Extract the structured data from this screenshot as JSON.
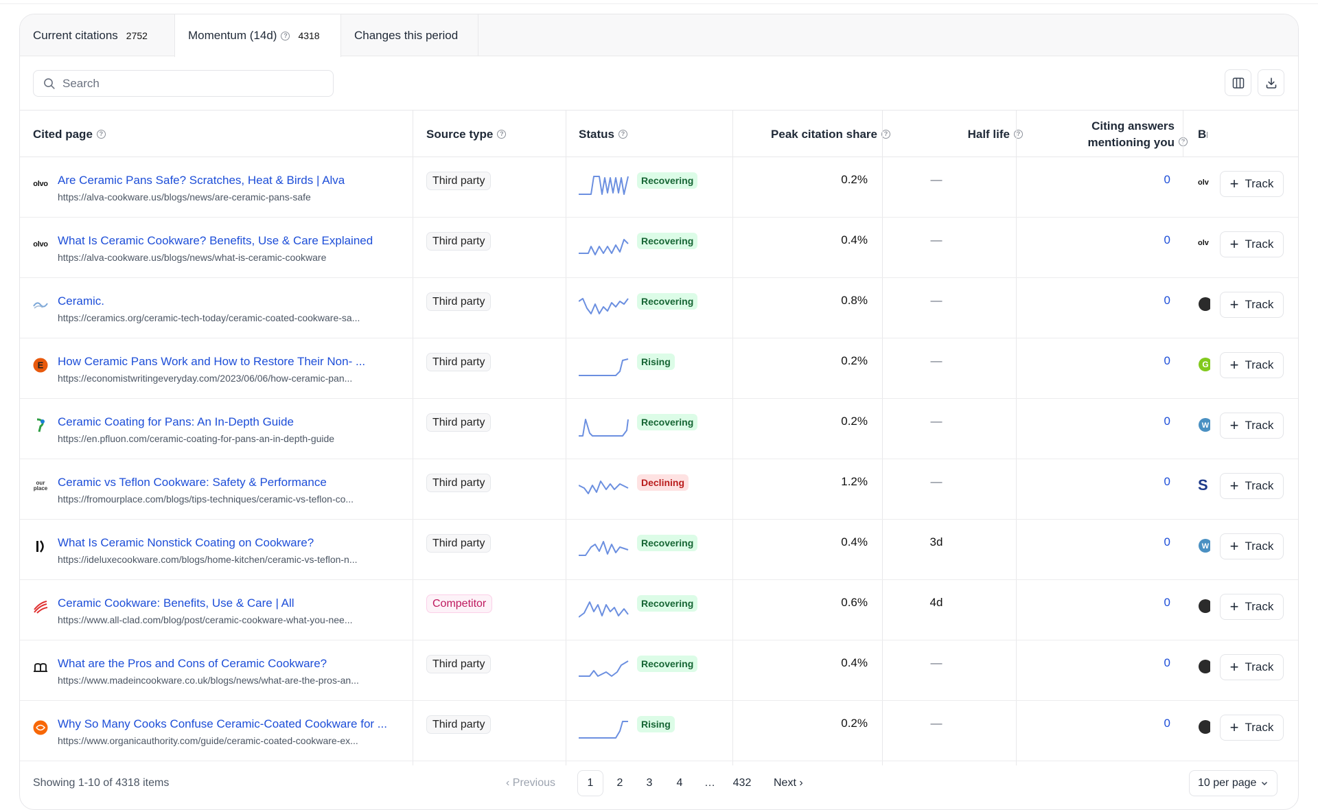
{
  "tabs": [
    {
      "label": "Current citations",
      "count": "2752"
    },
    {
      "label": "Momentum (14d)",
      "count": "4318"
    },
    {
      "label": "Changes this period",
      "count": ""
    }
  ],
  "search": {
    "placeholder": "Search"
  },
  "toolbar": {
    "columns_icon": "columns-icon",
    "download_icon": "download-icon"
  },
  "columns": {
    "cited_page": "Cited page",
    "source_type": "Source type",
    "status": "Status",
    "peak": "Peak citation share",
    "half_life": "Half life",
    "citing_line1": "Citing answers",
    "citing_line2": "mentioning you",
    "brand": "Br"
  },
  "track_label": "Track",
  "rows": [
    {
      "favicon": "olvo",
      "title": "Are Ceramic Pans Safe? Scratches, Heat & Birds | Alva",
      "url": "https://alva-cookware.us/blogs/news/are-ceramic-pans-safe",
      "source": "Third party",
      "status": "Recovering",
      "peak": "0.2%",
      "half_life": "—",
      "citing": "0",
      "brand": "olv"
    },
    {
      "favicon": "olvo",
      "title": "What Is Ceramic Cookware? Benefits, Use & Care Explained",
      "url": "https://alva-cookware.us/blogs/news/what-is-ceramic-cookware",
      "source": "Third party",
      "status": "Recovering",
      "peak": "0.4%",
      "half_life": "—",
      "citing": "0",
      "brand": "olv"
    },
    {
      "favicon": "ceramics",
      "title": "Ceramic.",
      "url": "https://ceramics.org/ceramic-tech-today/ceramic-coated-cookware-sa...",
      "source": "Third party",
      "status": "Recovering",
      "peak": "0.8%",
      "half_life": "—",
      "citing": "0",
      "brand": ""
    },
    {
      "favicon": "E",
      "title": "How Ceramic Pans Work and How to Restore Their Non- ...",
      "url": "https://economistwritingeveryday.com/2023/06/06/how-ceramic-pan...",
      "source": "Third party",
      "status": "Rising",
      "peak": "0.2%",
      "half_life": "—",
      "citing": "0",
      "brand": "G"
    },
    {
      "favicon": "pfluon",
      "title": "Ceramic Coating for Pans: An In-Depth Guide",
      "url": "https://en.pfluon.com/ceramic-coating-for-pans-an-in-depth-guide",
      "source": "Third party",
      "status": "Recovering",
      "peak": "0.2%",
      "half_life": "—",
      "citing": "0",
      "brand": "W"
    },
    {
      "favicon": "our place",
      "title": "Ceramic vs Teflon Cookware: Safety & Performance",
      "url": "https://fromourplace.com/blogs/tips-techniques/ceramic-vs-teflon-co...",
      "source": "Third party",
      "status": "Declining",
      "peak": "1.2%",
      "half_life": "—",
      "citing": "0",
      "brand": "S"
    },
    {
      "favicon": "I)",
      "title": "What Is Ceramic Nonstick Coating on Cookware?",
      "url": "https://ideluxecookware.com/blogs/home-kitchen/ceramic-vs-teflon-n...",
      "source": "Third party",
      "status": "Recovering",
      "peak": "0.4%",
      "half_life": "3d",
      "citing": "0",
      "brand": "W"
    },
    {
      "favicon": "allclad",
      "title": "Ceramic Cookware: Benefits, Use & Care | All",
      "url": "https://www.all-clad.com/blog/post/ceramic-cookware-what-you-nee...",
      "source": "Competitor",
      "status": "Recovering",
      "peak": "0.6%",
      "half_life": "4d",
      "citing": "0",
      "brand": ""
    },
    {
      "favicon": "m",
      "title": "What are the Pros and Cons of Ceramic Cookware?",
      "url": "https://www.madeincookware.co.uk/blogs/news/what-are-the-pros-an...",
      "source": "Third party",
      "status": "Recovering",
      "peak": "0.4%",
      "half_life": "—",
      "citing": "0",
      "brand": ""
    },
    {
      "favicon": "organic",
      "title": "Why So Many Cooks Confuse Ceramic-Coated Cookware for ...",
      "url": "https://www.organicauthority.com/guide/ceramic-coated-cookware-ex...",
      "source": "Third party",
      "status": "Rising",
      "peak": "0.2%",
      "half_life": "—",
      "citing": "0",
      "brand": ""
    }
  ],
  "footer": {
    "showing": "Showing 1-10 of 4318 items",
    "previous": "‹ Previous",
    "pages": [
      "1",
      "2",
      "3",
      "4",
      "…",
      "432"
    ],
    "next": "Next ›",
    "per_page": "10 per page"
  },
  "colors": {
    "link": "#1d4ed8",
    "recovering_bg": "#dcfce7",
    "declining_bg": "#fee2e2",
    "competitor": "#be185d"
  }
}
